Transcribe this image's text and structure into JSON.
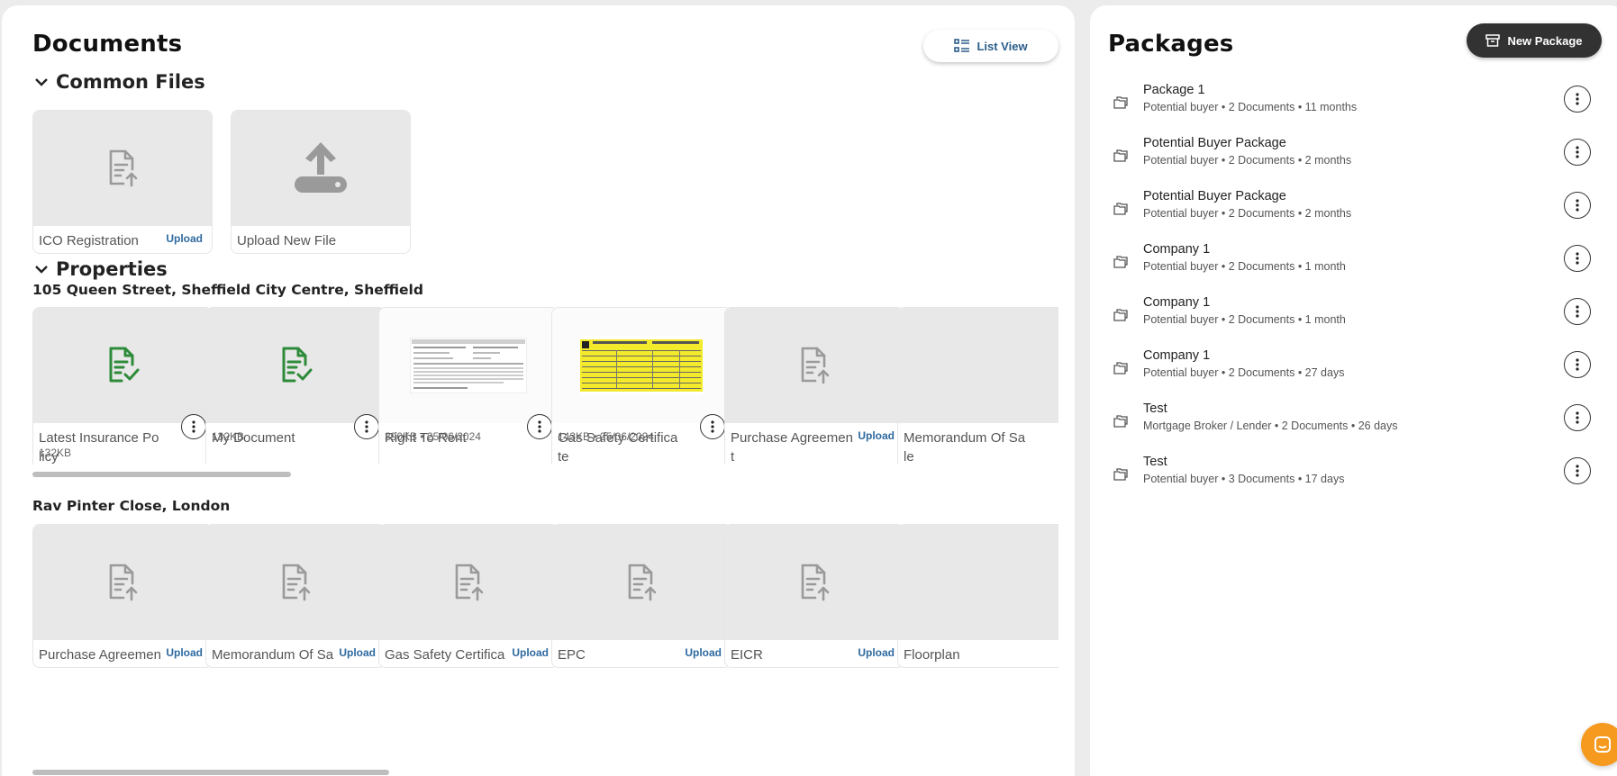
{
  "documents": {
    "title": "Documents",
    "list_view_label": "List View",
    "common_files": {
      "heading": "Common Files",
      "cards": [
        {
          "name": "ICO Registration",
          "action": "Upload"
        },
        {
          "name": "Upload New File"
        }
      ]
    },
    "properties": {
      "heading": "Properties",
      "groups": [
        {
          "address": "105 Queen Street, Sheffield City Centre, Sheffield",
          "cards": [
            {
              "name": "Latest Insurance Policy",
              "meta": "132KB"
            },
            {
              "name": "My Document",
              "meta": "132KB"
            },
            {
              "name": "Right To Rent",
              "meta": "390KB • 25/06/2024"
            },
            {
              "name": "Gas Safety Certificate",
              "meta": "143KB • 25/06/2024"
            },
            {
              "name": "Purchase Agreement",
              "action": "Upload"
            },
            {
              "name": "Memorandum Of Sale"
            }
          ]
        },
        {
          "address": "Rav Pinter Close, London",
          "cards": [
            {
              "name": "Purchase Agreement",
              "action": "Upload"
            },
            {
              "name": "Memorandum Of Sale",
              "action": "Upload"
            },
            {
              "name": "Gas Safety Certificate",
              "action": "Upload"
            },
            {
              "name": "EPC",
              "action": "Upload"
            },
            {
              "name": "EICR",
              "action": "Upload"
            },
            {
              "name": "Floorplan"
            }
          ]
        }
      ]
    }
  },
  "packages": {
    "title": "Packages",
    "new_package_label": "New Package",
    "items": [
      {
        "name": "Package 1",
        "meta": "Potential buyer • 2 Documents • 11 months"
      },
      {
        "name": "Potential Buyer Package",
        "meta": "Potential buyer • 2 Documents • 2 months"
      },
      {
        "name": "Potential Buyer Package",
        "meta": "Potential buyer • 2 Documents • 2 months"
      },
      {
        "name": "Company 1",
        "meta": "Potential buyer • 2 Documents • 1 month"
      },
      {
        "name": "Company 1",
        "meta": "Potential buyer • 2 Documents • 1 month"
      },
      {
        "name": "Company 1",
        "meta": "Potential buyer • 2 Documents • 27 days"
      },
      {
        "name": "Test",
        "meta": "Mortgage Broker / Lender • 2 Documents • 26 days"
      },
      {
        "name": "Test",
        "meta": "Potential buyer • 3 Documents • 17 days"
      }
    ]
  },
  "colors": {
    "accent_blue": "#2e6aa0",
    "success_green": "#2e8b3a",
    "dark_button": "#323232",
    "chat_orange": "#f59a1e"
  },
  "icons": {
    "list_view": "list-view-icon",
    "new_package": "archive-icon",
    "package": "stacked-folders-icon",
    "doc_upload": "document-upload-icon",
    "doc_ok": "document-check-icon",
    "upload_new": "upload-tray-icon",
    "kebab": "kebab-menu-icon",
    "chat": "chat-icon"
  }
}
